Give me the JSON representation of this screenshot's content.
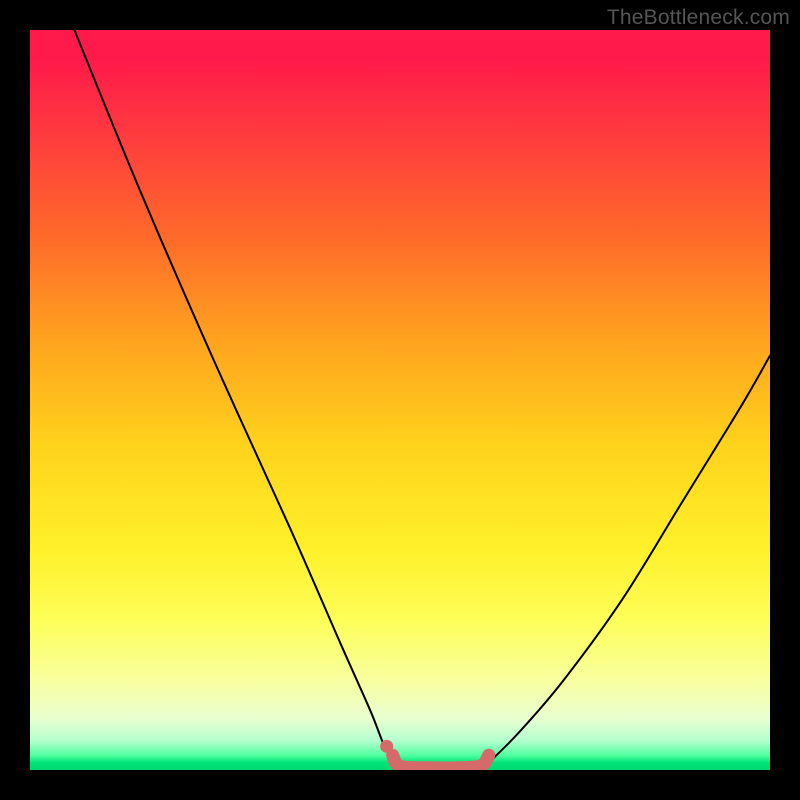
{
  "watermark": "TheBottleneck.com",
  "chart_data": {
    "type": "line",
    "title": "",
    "xlabel": "",
    "ylabel": "",
    "xlim": [
      0,
      100
    ],
    "ylim": [
      0,
      100
    ],
    "grid": false,
    "legend": false,
    "gradient_stops": [
      {
        "pos": 0,
        "color": "#ff1a4b"
      },
      {
        "pos": 4,
        "color": "#ff1a4b"
      },
      {
        "pos": 14,
        "color": "#ff3a3f"
      },
      {
        "pos": 28,
        "color": "#ff6a2a"
      },
      {
        "pos": 42,
        "color": "#ffa31f"
      },
      {
        "pos": 56,
        "color": "#ffd21c"
      },
      {
        "pos": 70,
        "color": "#fff02a"
      },
      {
        "pos": 80,
        "color": "#fdff5a"
      },
      {
        "pos": 88,
        "color": "#f8ffa0"
      },
      {
        "pos": 93,
        "color": "#e9ffd0"
      },
      {
        "pos": 96,
        "color": "#b6ffcf"
      },
      {
        "pos": 98,
        "color": "#52ffa1"
      },
      {
        "pos": 99,
        "color": "#00e47a"
      },
      {
        "pos": 100,
        "color": "#00d66f"
      }
    ],
    "series": [
      {
        "name": "left-branch",
        "x": [
          6,
          15,
          25,
          35,
          42,
          46,
          48,
          49.5
        ],
        "y": [
          100,
          78,
          55,
          33,
          17,
          8,
          3,
          1
        ]
      },
      {
        "name": "right-branch",
        "x": [
          62,
          66,
          72,
          80,
          88,
          96,
          100
        ],
        "y": [
          1,
          5,
          12,
          23,
          36,
          49,
          56
        ]
      },
      {
        "name": "valley-marker",
        "color": "#d66a6a",
        "x": [
          49,
          50,
          54,
          58,
          61,
          62
        ],
        "y": [
          2,
          0.5,
          0.3,
          0.3,
          0.6,
          2
        ]
      },
      {
        "name": "valley-marker-dot",
        "color": "#d66a6a",
        "x": [
          48.2
        ],
        "y": [
          3.2
        ]
      }
    ]
  }
}
